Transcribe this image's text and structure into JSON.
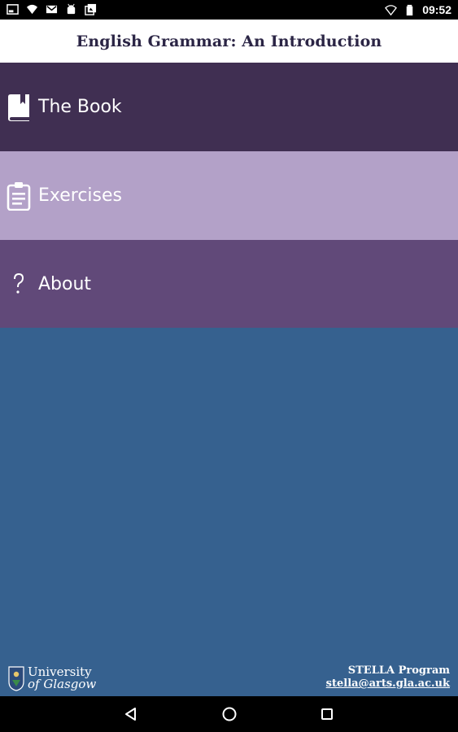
{
  "status_bar": {
    "time": "09:52",
    "left_icons": [
      "screenshot-icon",
      "wifi-notification-icon",
      "gmail-icon",
      "android-icon",
      "photos-icon"
    ],
    "right_icons": [
      "wifi-icon",
      "battery-icon"
    ]
  },
  "header": {
    "title": "English Grammar: An Introduction"
  },
  "menu": {
    "items": [
      {
        "label": "The Book",
        "icon": "book-icon",
        "color": "#402f52"
      },
      {
        "label": "Exercises",
        "icon": "clipboard-icon",
        "color": "#b3a1c8"
      },
      {
        "label": "About",
        "icon": "question-icon",
        "color": "#614979"
      }
    ]
  },
  "footer": {
    "university_line1": "University",
    "university_line2": "of Glasgow",
    "program": "STELLA Program",
    "email": "stella@arts.gla.ac.uk"
  },
  "nav_bar": {
    "buttons": [
      "back-icon",
      "home-icon",
      "recents-icon"
    ]
  },
  "colors": {
    "background": "#36618f",
    "title_text": "#2b2545"
  }
}
